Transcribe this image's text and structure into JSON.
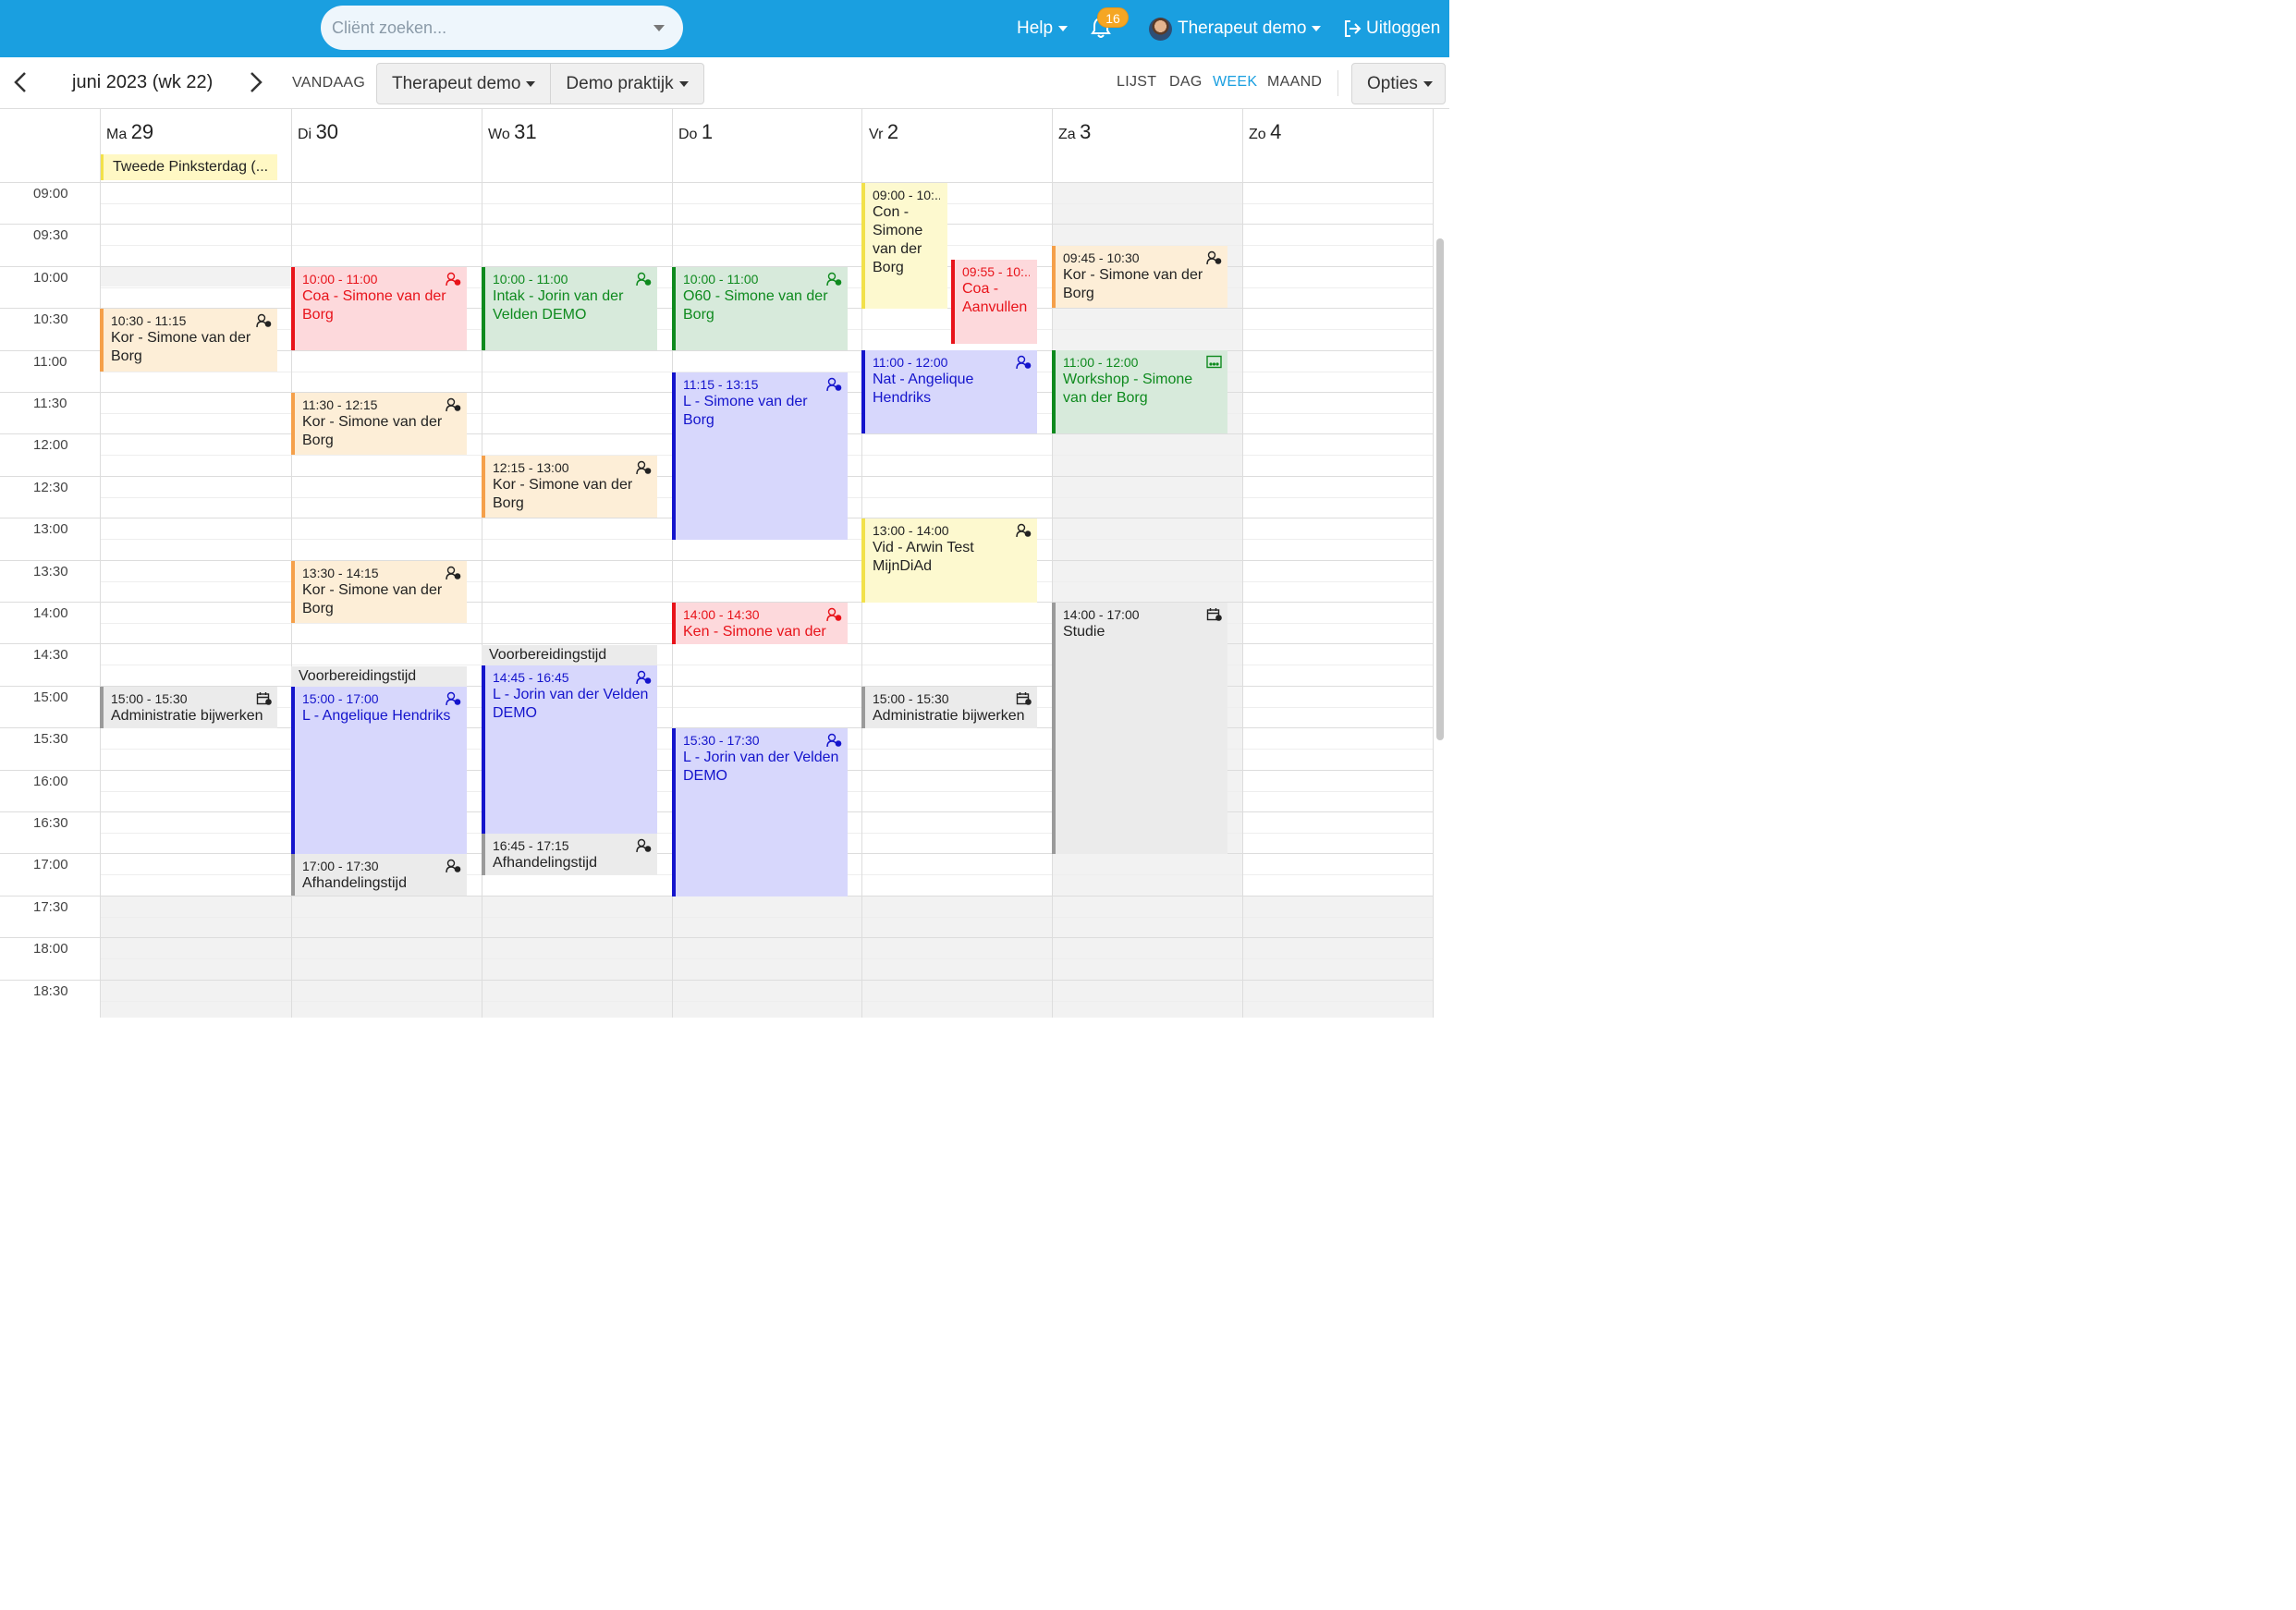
{
  "topbar": {
    "search_placeholder": "Cliënt zoeken...",
    "help": "Help",
    "notifications_count": "16",
    "user": "Therapeut demo",
    "logout": "Uitloggen"
  },
  "toolbar": {
    "period": "juni 2023 (wk 22)",
    "today": "VANDAAG",
    "therapist": "Therapeut demo",
    "practice": "Demo praktijk",
    "views": [
      "LIJST",
      "DAG",
      "WEEK",
      "MAAND"
    ],
    "active_view": "WEEK",
    "options": "Opties"
  },
  "days": [
    {
      "dow": "Ma",
      "num": "29"
    },
    {
      "dow": "Di",
      "num": "30"
    },
    {
      "dow": "Wo",
      "num": "31"
    },
    {
      "dow": "Do",
      "num": "1"
    },
    {
      "dow": "Vr",
      "num": "2"
    },
    {
      "dow": "Za",
      "num": "3"
    },
    {
      "dow": "Zo",
      "num": "4"
    }
  ],
  "allday_event": "Tweede Pinksterdag (...",
  "times": [
    "09:00",
    "09:30",
    "10:00",
    "10:30",
    "11:00",
    "11:30",
    "12:00",
    "12:30",
    "13:00",
    "13:30",
    "14:00",
    "14:30",
    "15:00",
    "15:30",
    "16:00",
    "16:30",
    "17:00",
    "17:30",
    "18:00",
    "18:30"
  ],
  "colors": {
    "red": "#e8131a",
    "green": "#0e8a1e",
    "orange": "#f5a04a",
    "blue": "#1414cc",
    "yellow": "#f2e14a",
    "gray": "#9a9a9a",
    "brand": "#1a9fe0"
  },
  "events": [
    {
      "time": "10:30 - 11:15",
      "title": "Kor - Simone van der Borg",
      "color": "orange",
      "icon": "client-icon"
    },
    {
      "time": "15:00 - 15:30",
      "title": "Administratie bijwerken",
      "color": "gray",
      "icon": "calendar-icon"
    },
    {
      "time": "10:00 - 11:00",
      "title": "Coa - Simone van der Borg",
      "color": "red",
      "icon": "client-icon"
    },
    {
      "time": "11:30 - 12:15",
      "title": "Kor - Simone van der Borg",
      "color": "orange",
      "icon": "client-icon"
    },
    {
      "time": "13:30 - 14:15",
      "title": "Kor - Simone van der Borg",
      "color": "orange",
      "icon": "client-icon"
    },
    {
      "time": "15:00 - 17:00",
      "title": "L - Angelique Hendriks",
      "color": "blue",
      "icon": "client-icon"
    },
    {
      "time": "17:00 - 17:30",
      "title": "Afhandelingstijd",
      "color": "gray",
      "icon": "client-icon"
    },
    {
      "time": "10:00 - 11:00",
      "title": "Intak - Jorin van der Velden DEMO",
      "color": "green",
      "icon": "client-icon"
    },
    {
      "time": "12:15 - 13:00",
      "title": "Kor - Simone van der Borg",
      "color": "orange",
      "icon": "client-icon"
    },
    {
      "time": "14:45 - 16:45",
      "title": "L - Jorin van der Velden DEMO",
      "color": "blue",
      "icon": "client-icon"
    },
    {
      "time": "16:45 - 17:15",
      "title": "Afhandelingstijd",
      "color": "gray",
      "icon": "client-icon"
    },
    {
      "time": "10:00 - 11:00",
      "title": "O60 - Simone van der Borg",
      "color": "green",
      "icon": "client-icon"
    },
    {
      "time": "11:15 - 13:15",
      "title": "L - Simone van der Borg",
      "color": "blue",
      "icon": "client-icon"
    },
    {
      "time": "14:00 - 14:30",
      "title": "Ken - Simone van der",
      "color": "red",
      "icon": "client-icon"
    },
    {
      "time": "15:30 - 17:30",
      "title": "L - Jorin van der Velden DEMO",
      "color": "blue",
      "icon": "client-icon"
    },
    {
      "time": "09:00 - 10:...",
      "title": "Con - Simone van der Borg",
      "color": "yellow",
      "icon": ""
    },
    {
      "time": "09:55 - 10:...",
      "title": "Coa - Aanvullen",
      "color": "red",
      "icon": ""
    },
    {
      "time": "11:00 - 12:00",
      "title": "Nat - Angelique Hendriks",
      "color": "blue",
      "icon": "client-icon"
    },
    {
      "time": "13:00 - 14:00",
      "title": "Vid - Arwin Test MijnDiAd",
      "color": "yellow",
      "icon": "client-icon"
    },
    {
      "time": "15:00 - 15:30",
      "title": "Administratie bijwerken",
      "color": "gray",
      "icon": "calendar-icon"
    },
    {
      "time": "09:45 - 10:30",
      "title": "Kor - Simone van der Borg",
      "color": "orange",
      "icon": "client-icon"
    },
    {
      "time": "11:00 - 12:00",
      "title": "Workshop - Simone van der Borg",
      "color": "green",
      "icon": "group-icon"
    },
    {
      "time": "14:00 - 17:00",
      "title": "Studie",
      "color": "gray",
      "icon": "calendar-icon"
    }
  ],
  "prep_blocks": [
    "Voorbereidingstijd",
    "Voorbereidingstijd"
  ]
}
